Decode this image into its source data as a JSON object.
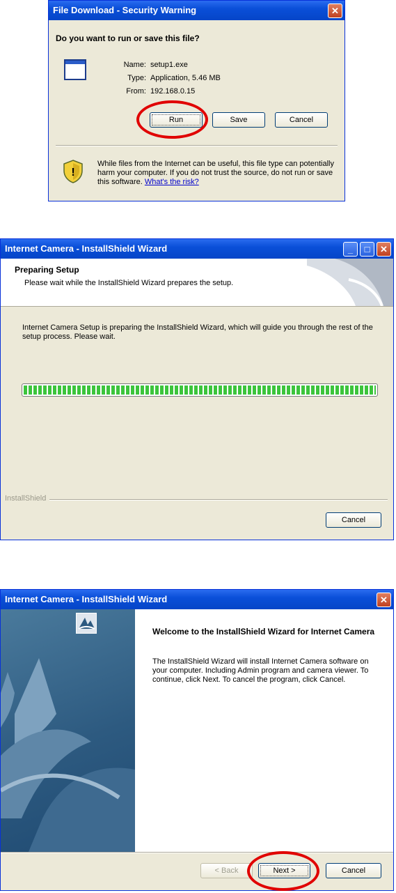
{
  "dialog1": {
    "title": "File Download - Security Warning",
    "question": "Do you want to run or save this file?",
    "name_label": "Name:",
    "name_value": "setup1.exe",
    "type_label": "Type:",
    "type_value": "Application, 5.46 MB",
    "from_label": "From:",
    "from_value": "192.168.0.15",
    "run_label": "Run",
    "save_label": "Save",
    "cancel_label": "Cancel",
    "warning_text": "While files from the Internet can be useful, this file type can potentially harm your computer. If you do not trust the source, do not run or save this software.",
    "risk_link": "What's the risk?",
    "close_glyph": "✕"
  },
  "dialog2": {
    "title": "Internet Camera - InstallShield Wizard",
    "header_title": "Preparing Setup",
    "header_subtitle": "Please wait while the InstallShield Wizard prepares the setup.",
    "body_text": "Internet Camera Setup is preparing the InstallShield Wizard, which will guide you through the rest of the setup process. Please wait.",
    "progress": 1.0,
    "brand": "InstallShield",
    "cancel_label": "Cancel",
    "min_glyph": "_",
    "max_glyph": "□",
    "close_glyph": "✕"
  },
  "dialog3": {
    "title": "Internet Camera - InstallShield Wizard",
    "welcome_heading": "Welcome to the InstallShield Wizard for Internet Camera",
    "welcome_text": "The InstallShield Wizard will install Internet Camera software on your computer. Including Admin program and camera viewer. To continue, click Next. To cancel the program, click Cancel.",
    "back_label": "< Back",
    "next_label": "Next >",
    "cancel_label": "Cancel",
    "close_glyph": "✕"
  },
  "colors": {
    "highlight_ring": "#e00000",
    "progress_green": "#3cc43c",
    "title_blue": "#0a4fd8"
  }
}
